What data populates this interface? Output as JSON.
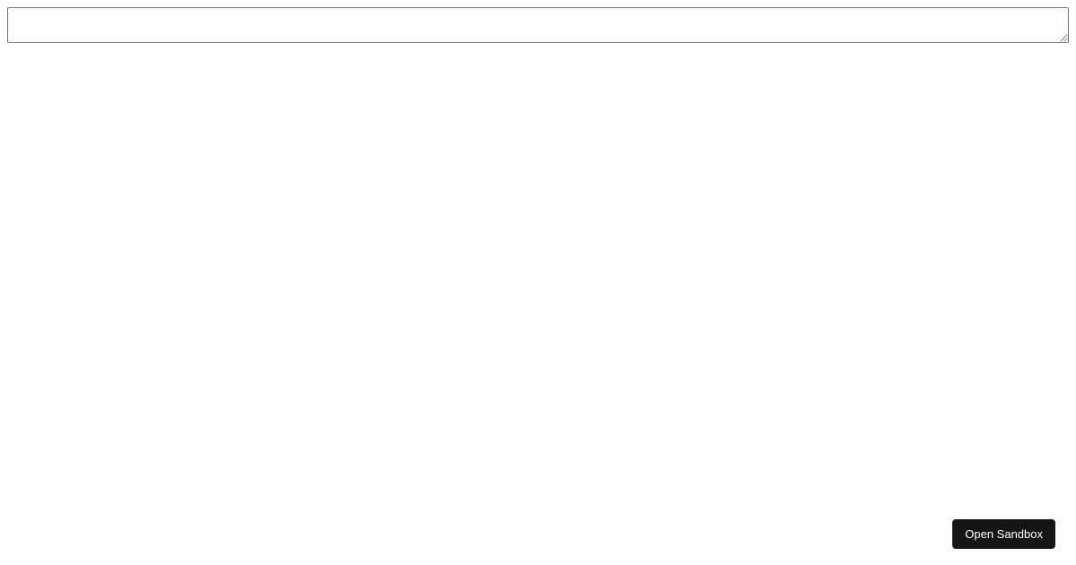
{
  "textarea": {
    "value": "",
    "placeholder": ""
  },
  "buttons": {
    "open_sandbox_label": "Open Sandbox"
  }
}
